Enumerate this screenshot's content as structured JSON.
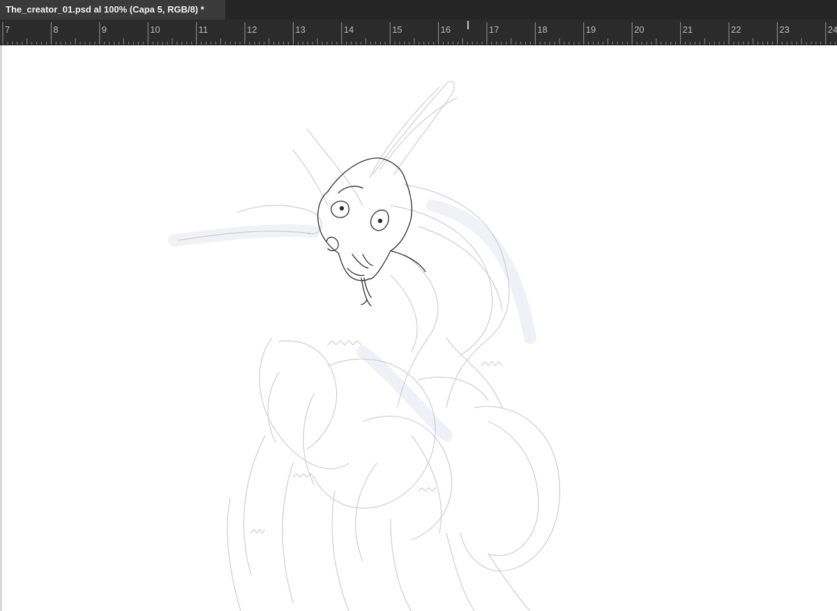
{
  "document_tab": {
    "title": "The_creator_01.psd al 100% (Capa 5, RGB/8) *"
  },
  "ruler": {
    "labels": [
      "7",
      "8",
      "9",
      "10",
      "11",
      "12",
      "13",
      "14",
      "15",
      "16",
      "17",
      "18",
      "19",
      "20",
      "21",
      "22",
      "23",
      "24"
    ]
  },
  "colors": {
    "tab_background": "#3a3a3a",
    "ruler_background": "#2b2b2b",
    "canvas_background": "#ffffff",
    "sketch_light": "#c9c2c4",
    "sketch_dark": "#2a2a2a"
  }
}
